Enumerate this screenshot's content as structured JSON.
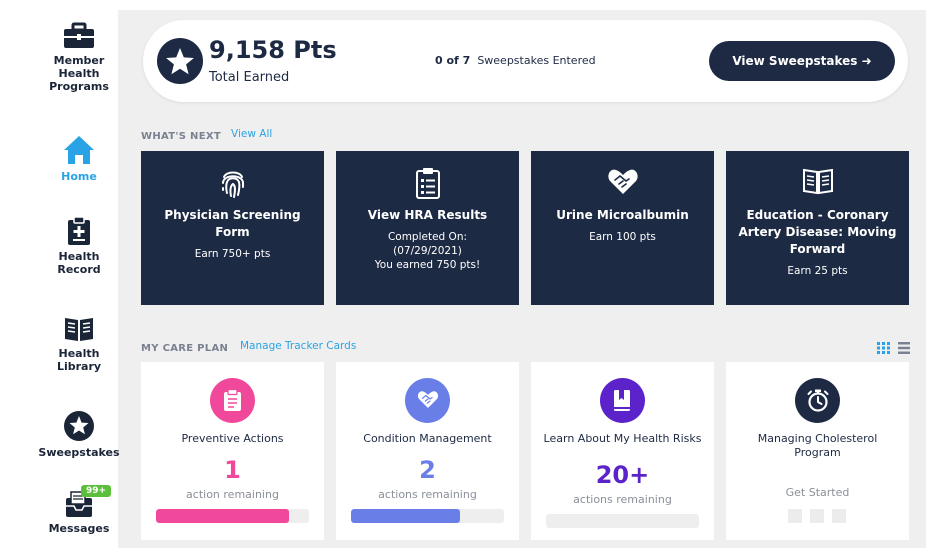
{
  "sidebar": {
    "items": [
      {
        "label_lines": [
          "Member",
          "Health",
          "Programs"
        ],
        "icon": "briefcase-icon",
        "active": false
      },
      {
        "label_lines": [
          "Home"
        ],
        "icon": "home-icon",
        "active": true
      },
      {
        "label_lines": [
          "Health",
          "Record"
        ],
        "icon": "clipboard-plus-icon",
        "active": false
      },
      {
        "label_lines": [
          "Health",
          "Library"
        ],
        "icon": "book-icon",
        "active": false
      },
      {
        "label_lines": [
          "Sweepstakes"
        ],
        "icon": "star-icon",
        "active": false
      },
      {
        "label_lines": [
          "Messages"
        ],
        "icon": "inbox-icon",
        "active": false,
        "badge": "99+"
      }
    ]
  },
  "points": {
    "value": "9,158 Pts",
    "label": "Total Earned",
    "sweep_count": "0 of 7",
    "sweep_label": "Sweepstakes Entered",
    "view_button": "View Sweepstakes ➜"
  },
  "whats_next": {
    "title": "WHAT'S NEXT",
    "link": "View All",
    "cards": [
      {
        "icon": "fingerprint-icon",
        "title": "Physician Screening Form",
        "sub_lines": [
          "Earn 750+ pts"
        ]
      },
      {
        "icon": "clipboard-list-icon",
        "title": "View HRA Results",
        "sub_lines": [
          "Completed On:",
          "(07/29/2021)",
          "You earned 750 pts!"
        ]
      },
      {
        "icon": "handshake-heart-icon",
        "title": "Urine Microalbumin",
        "sub_lines": [
          "Earn 100 pts"
        ]
      },
      {
        "icon": "open-book-icon",
        "title": "Education - Coronary Artery Disease: Moving Forward",
        "sub_lines": [
          "Earn 25 pts"
        ]
      }
    ]
  },
  "care_plan": {
    "title": "MY CARE PLAN",
    "link": "Manage Tracker Cards",
    "cards": [
      {
        "icon": "clipboard-icon",
        "title": "Preventive Actions",
        "count": "1",
        "sub": "action remaining",
        "progress": 0.87,
        "color": "#f0489a",
        "icon_bg": "#f0489a"
      },
      {
        "icon": "handshake-heart-icon",
        "title": "Condition Management",
        "count": "2",
        "sub": "actions remaining",
        "progress": 0.71,
        "color": "#6a7ee8",
        "icon_bg": "#6a7ee8"
      },
      {
        "icon": "bookmark-book-icon",
        "title": "Learn About My Health Risks",
        "count": "20+",
        "sub": "actions remaining",
        "progress": 0.0,
        "color": "#5b23c9",
        "icon_bg": "#5b23c9"
      },
      {
        "icon": "stopwatch-icon",
        "title": "Managing Cholesterol Program",
        "get_started": "Get Started",
        "icon_bg": "#1e2a44"
      }
    ]
  }
}
